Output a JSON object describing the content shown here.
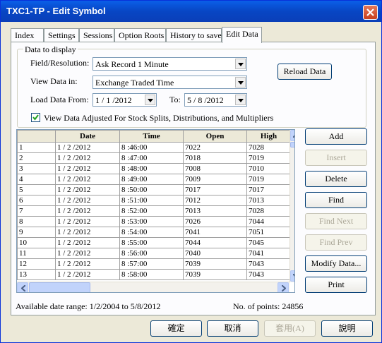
{
  "window": {
    "title": "TXC1-TP - Edit Symbol"
  },
  "tabs": [
    "Index",
    "Settings",
    "Sessions",
    "Option Roots",
    "History to save",
    "Edit Data"
  ],
  "active_tab": "Edit Data",
  "display_group": {
    "label": "Data to display",
    "field_label": "Field/Resolution:",
    "field_value": "Ask Record 1 Minute",
    "view_label": "View Data in:",
    "view_value": "Exchange Traded Time",
    "load_from_label": "Load Data From:",
    "load_from_value": "1 / 1 /2012",
    "to_label": "To:",
    "to_value": "5 / 8 /2012",
    "adjust_checkbox_label": "View Data Adjusted For Stock Splits, Distributions, and Multipliers",
    "adjust_checked": true,
    "reload_button": "Reload Data"
  },
  "grid": {
    "columns": [
      "Date",
      "Time",
      "Open",
      "High"
    ],
    "rows": [
      {
        "n": "1",
        "date": "1 / 2 /2012",
        "time": "8 :46:00",
        "open": "7022",
        "high": "7028"
      },
      {
        "n": "2",
        "date": "1 / 2 /2012",
        "time": "8 :47:00",
        "open": "7018",
        "high": "7019"
      },
      {
        "n": "3",
        "date": "1 / 2 /2012",
        "time": "8 :48:00",
        "open": "7008",
        "high": "7010"
      },
      {
        "n": "4",
        "date": "1 / 2 /2012",
        "time": "8 :49:00",
        "open": "7009",
        "high": "7019"
      },
      {
        "n": "5",
        "date": "1 / 2 /2012",
        "time": "8 :50:00",
        "open": "7017",
        "high": "7017"
      },
      {
        "n": "6",
        "date": "1 / 2 /2012",
        "time": "8 :51:00",
        "open": "7012",
        "high": "7013"
      },
      {
        "n": "7",
        "date": "1 / 2 /2012",
        "time": "8 :52:00",
        "open": "7013",
        "high": "7028"
      },
      {
        "n": "8",
        "date": "1 / 2 /2012",
        "time": "8 :53:00",
        "open": "7026",
        "high": "7044"
      },
      {
        "n": "9",
        "date": "1 / 2 /2012",
        "time": "8 :54:00",
        "open": "7041",
        "high": "7051"
      },
      {
        "n": "10",
        "date": "1 / 2 /2012",
        "time": "8 :55:00",
        "open": "7044",
        "high": "7045"
      },
      {
        "n": "11",
        "date": "1 / 2 /2012",
        "time": "8 :56:00",
        "open": "7040",
        "high": "7041"
      },
      {
        "n": "12",
        "date": "1 / 2 /2012",
        "time": "8 :57:00",
        "open": "7039",
        "high": "7043"
      },
      {
        "n": "13",
        "date": "1 / 2 /2012",
        "time": "8 :58:00",
        "open": "7039",
        "high": "7043"
      }
    ]
  },
  "side_buttons": {
    "add": "Add",
    "insert": "Insert",
    "delete": "Delete",
    "find": "Find",
    "find_next": "Find Next",
    "find_prev": "Find Prev",
    "modify": "Modify Data...",
    "print": "Print"
  },
  "status": {
    "date_range": "Available date range: 1/2/2004 to 5/8/2012",
    "points": "No. of points: 24856"
  },
  "footer_buttons": {
    "ok": "確定",
    "cancel": "取消",
    "apply": "套用(A)",
    "help": "說明"
  }
}
